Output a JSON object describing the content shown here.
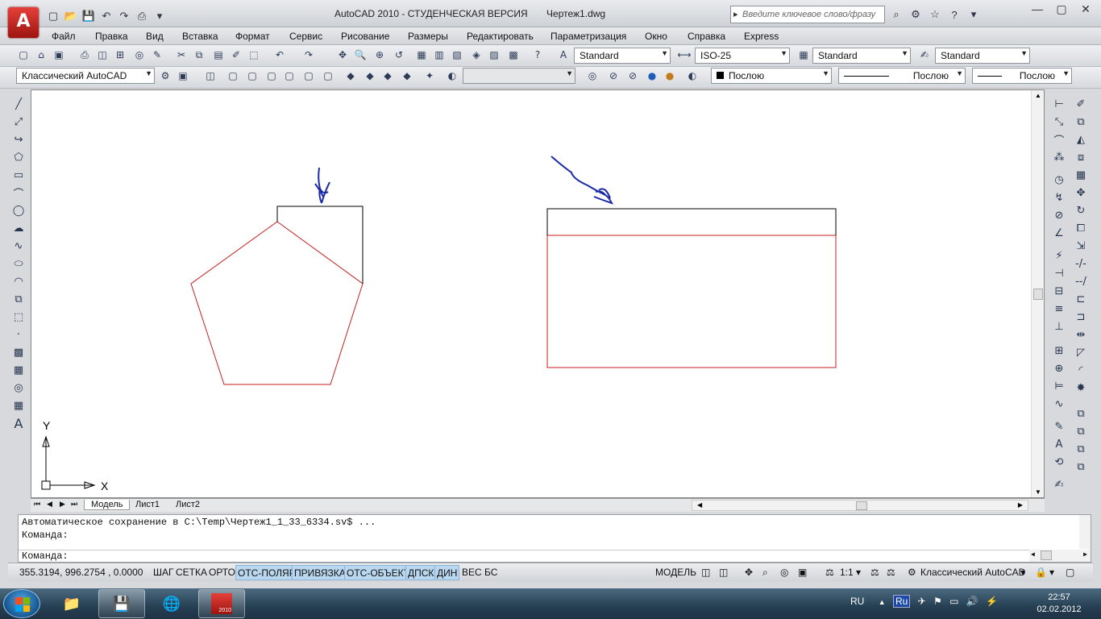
{
  "window": {
    "title": "AutoCAD 2010 - СТУДЕНЧЕСКАЯ ВЕРСИЯ",
    "document": "Чертеж1.dwg",
    "search_placeholder": "Введите ключевое слово/фразу"
  },
  "app_button": "A",
  "menu": [
    "Файл",
    "Правка",
    "Вид",
    "Вставка",
    "Формат",
    "Сервис",
    "Рисование",
    "Размеры",
    "Редактировать",
    "Параметризация",
    "Окно",
    "Справка",
    "Express"
  ],
  "styles_toolbar": {
    "text_style": "Standard",
    "dim_style": "ISO-25",
    "table_style": "Standard",
    "mleader_style": "Standard"
  },
  "workspace_toolbar": {
    "workspace": "Классический AutoCAD",
    "layer": "",
    "color": "Послою",
    "linetype": "Послою",
    "lineweight": "Послою"
  },
  "ucs": {
    "x": "X",
    "y": "Y"
  },
  "layout_tabs": [
    "Модель",
    "Лист1",
    "Лист2"
  ],
  "command_window": {
    "line1": "Автоматическое сохранение в C:\\Temp\\Чертеж1_1_33_6334.sv$ ...",
    "line2": "Команда:",
    "prompt": "Команда:"
  },
  "status_bar": {
    "coords": "355.3194, 996.2754 , 0.0000",
    "toggles": [
      {
        "label": "ШАГ",
        "on": false
      },
      {
        "label": "СЕТКА",
        "on": false
      },
      {
        "label": "ОРТО",
        "on": false
      },
      {
        "label": "ОТС-ПОЛЯР",
        "on": true
      },
      {
        "label": "ПРИВЯЗКА",
        "on": true
      },
      {
        "label": "ОТС-ОБЪЕКТ",
        "on": true
      },
      {
        "label": "ДПСК",
        "on": true
      },
      {
        "label": "ДИН",
        "on": true
      },
      {
        "label": "ВЕС",
        "on": false
      },
      {
        "label": "БС",
        "on": false
      }
    ],
    "model": "МОДЕЛЬ",
    "scale": "1:1",
    "workspace": "Классический AutoCAD"
  },
  "taskbar": {
    "lang": "RU",
    "lang_badge": "Ru",
    "time": "22:57",
    "date": "02.02.2012",
    "autocad_badge": "2010"
  },
  "colors": {
    "red_line": "#c81e1e",
    "black_line": "#000000",
    "annotation": "#1a2aa8",
    "status_on": "#b9d7ef"
  }
}
